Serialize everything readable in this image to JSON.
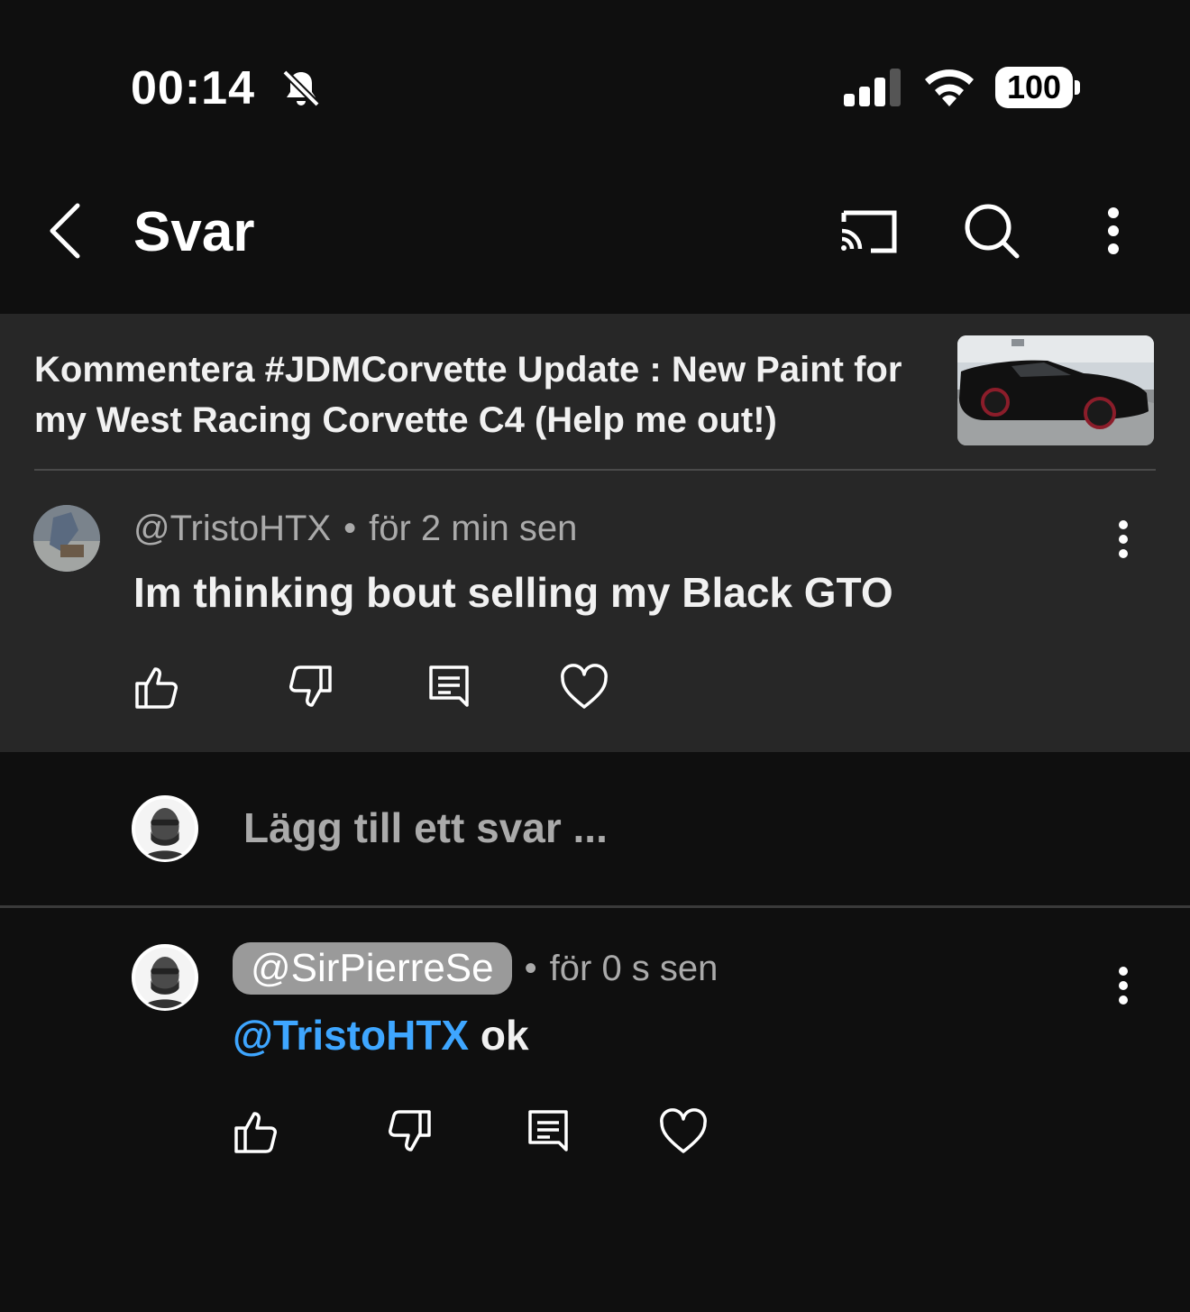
{
  "status_bar": {
    "time": "00:14",
    "battery": "100"
  },
  "app_bar": {
    "title": "Svar"
  },
  "parent": {
    "video_title": "Kommentera #JDMCorvette Update : New Paint for my West Racing Corvette C4 (Help me out!)",
    "author": "@TristoHTX",
    "separator": "•",
    "time": "för 2 min sen",
    "text": "Im thinking bout selling my Black GTO"
  },
  "reply_input": {
    "placeholder": "Lägg till ett svar ..."
  },
  "reply": {
    "author": "@SirPierreSe",
    "separator": "•",
    "time": "för 0 s sen",
    "mention": "@TristoHTX",
    "text": " ok"
  },
  "colors": {
    "background": "#0f0f0f",
    "panel": "#272727",
    "mention": "#3ea6ff",
    "chip": "#9a9a9a"
  },
  "icons": [
    "bell-off-icon",
    "signal-icon",
    "wifi-icon",
    "back-icon",
    "cast-icon",
    "search-icon",
    "more-vert-icon",
    "thumb-up-icon",
    "thumb-down-icon",
    "reply-icon",
    "heart-icon"
  ]
}
